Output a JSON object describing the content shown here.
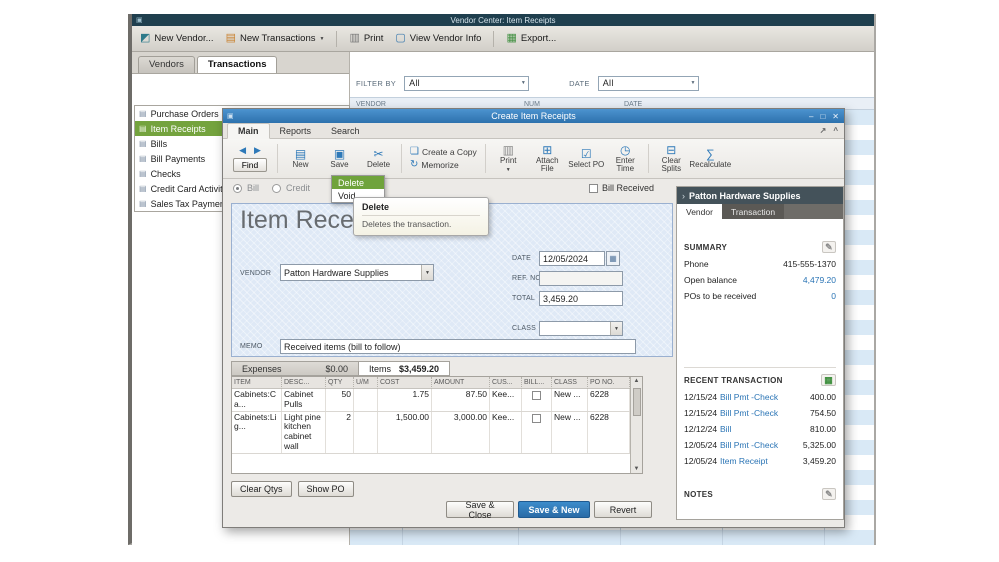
{
  "icons": {
    "window": "▣",
    "new_vendor": "◩",
    "new_transactions": "▤",
    "print": "▥",
    "view_vendor_info": "▢",
    "export": "▦",
    "dropdown_arrow": "▼",
    "back": "◀",
    "forward": "▶",
    "new": "▤",
    "save": "▣",
    "delete": "✂",
    "create_copy": "❏",
    "memorize": "↻",
    "attach_file": "⊞",
    "select_po": "☑",
    "enter_time": "◷",
    "clear_splits": "⊟",
    "recalculate": "∑",
    "calendar": "▦",
    "pencil": "✎",
    "report": "▦",
    "chevron_right": "›",
    "form": "▤",
    "minimize": "–",
    "maximize": "□",
    "close": "✕",
    "expand": "↗",
    "collapse": "^",
    "scroll_up": "▲",
    "scroll_down": "▼"
  },
  "vendor_center": {
    "window_title": "Vendor Center: Item Receipts",
    "toolbar": {
      "new_vendor": "New Vendor...",
      "new_transactions": "New Transactions",
      "print": "Print",
      "view_vendor_info": "View Vendor Info",
      "export": "Export..."
    },
    "tabs": {
      "vendors": "Vendors",
      "transactions": "Transactions"
    },
    "transaction_types": [
      {
        "label": "Purchase Orders",
        "selected": false
      },
      {
        "label": "Item Receipts",
        "selected": true
      },
      {
        "label": "Bills",
        "selected": false
      },
      {
        "label": "Bill Payments",
        "selected": false
      },
      {
        "label": "Checks",
        "selected": false
      },
      {
        "label": "Credit Card Activities",
        "selected": false
      },
      {
        "label": "Sales Tax Payments",
        "selected": false
      }
    ],
    "filters": {
      "filter_by_label": "FILTER BY",
      "filter_by_value": "All",
      "date_label": "DATE",
      "date_value": "All"
    },
    "list_headers": [
      "VENDOR",
      "NUM",
      "DATE"
    ]
  },
  "dialog": {
    "title": "Create Item Receipts",
    "tabs": {
      "main": "Main",
      "reports": "Reports",
      "search": "Search"
    },
    "ribbon": {
      "find": "Find",
      "new": "New",
      "save": "Save",
      "delete": "Delete",
      "create_copy": "Create a Copy",
      "memorize": "Memorize",
      "print": "Print",
      "attach_file": "Attach File",
      "select_po": "Select PO",
      "enter_time": "Enter Time",
      "clear_splits": "Clear Splits",
      "recalculate": "Recalculate"
    },
    "delete_menu": {
      "delete": "Delete",
      "void": "Void"
    },
    "tooltip": {
      "title": "Delete",
      "text": "Deletes the transaction."
    },
    "type_options": {
      "bill": "Bill",
      "credit": "Credit"
    },
    "bill_received_label": "Bill Received",
    "form": {
      "heading": "Item Receipt",
      "vendor_label": "VENDOR",
      "vendor_value": "Patton Hardware Supplies",
      "date_label": "DATE",
      "date_value": "12/05/2024",
      "ref_no_label": "REF. NO",
      "ref_no_value": "",
      "total_label": "TOTAL",
      "total_value": "3,459.20",
      "class_label": "CLASS",
      "class_value": "",
      "memo_label": "MEMO",
      "memo_value": "Received items (bill to follow)"
    },
    "detail_tabs": {
      "expenses_label": "Expenses",
      "expenses_amount": "$0.00",
      "items_label": "Items",
      "items_amount": "$3,459.20"
    },
    "items_table": {
      "headers": [
        "ITEM",
        "DESC...",
        "QTY",
        "U/M",
        "COST",
        "AMOUNT",
        "CUS...",
        "BILL...",
        "CLASS",
        "PO NO."
      ],
      "rows": [
        {
          "item": "Cabinets:Ca...",
          "desc": "Cabinet Pulls",
          "qty": "50",
          "um": "",
          "cost": "1.75",
          "amount": "87.50",
          "customer": "Kee...",
          "billable": false,
          "class": "New ...",
          "po_no": "6228"
        },
        {
          "item": "Cabinets:Lig...",
          "desc": "Light pine kitchen cabinet wall",
          "qty": "2",
          "um": "",
          "cost": "1,500.00",
          "amount": "3,000.00",
          "customer": "Kee...",
          "billable": false,
          "class": "New ...",
          "po_no": "6228"
        }
      ]
    },
    "table_buttons": {
      "clear_qtys": "Clear Qtys",
      "show_po": "Show PO"
    },
    "footer_buttons": {
      "save_close": "Save & Close",
      "save_new": "Save & New",
      "revert": "Revert"
    }
  },
  "vendor_panel": {
    "title": "Patton Hardware Supplies",
    "tabs": {
      "vendor": "Vendor",
      "transaction": "Transaction"
    },
    "summary_heading": "SUMMARY",
    "summary": [
      {
        "label": "Phone",
        "value": "415-555-1370",
        "link": false
      },
      {
        "label": "Open balance",
        "value": "4,479.20",
        "link": true
      },
      {
        "label": "POs to be received",
        "value": "0",
        "link": true
      }
    ],
    "recent_heading": "RECENT TRANSACTION",
    "recent": [
      {
        "date": "12/15/24",
        "type": "Bill Pmt -Check",
        "amount": "400.00"
      },
      {
        "date": "12/15/24",
        "type": "Bill Pmt -Check",
        "amount": "754.50"
      },
      {
        "date": "12/12/24",
        "type": "Bill",
        "amount": "810.00"
      },
      {
        "date": "12/05/24",
        "type": "Bill Pmt -Check",
        "amount": "5,325.00"
      },
      {
        "date": "12/05/24",
        "type": "Item Receipt",
        "amount": "3,459.20"
      }
    ],
    "notes_heading": "NOTES"
  }
}
